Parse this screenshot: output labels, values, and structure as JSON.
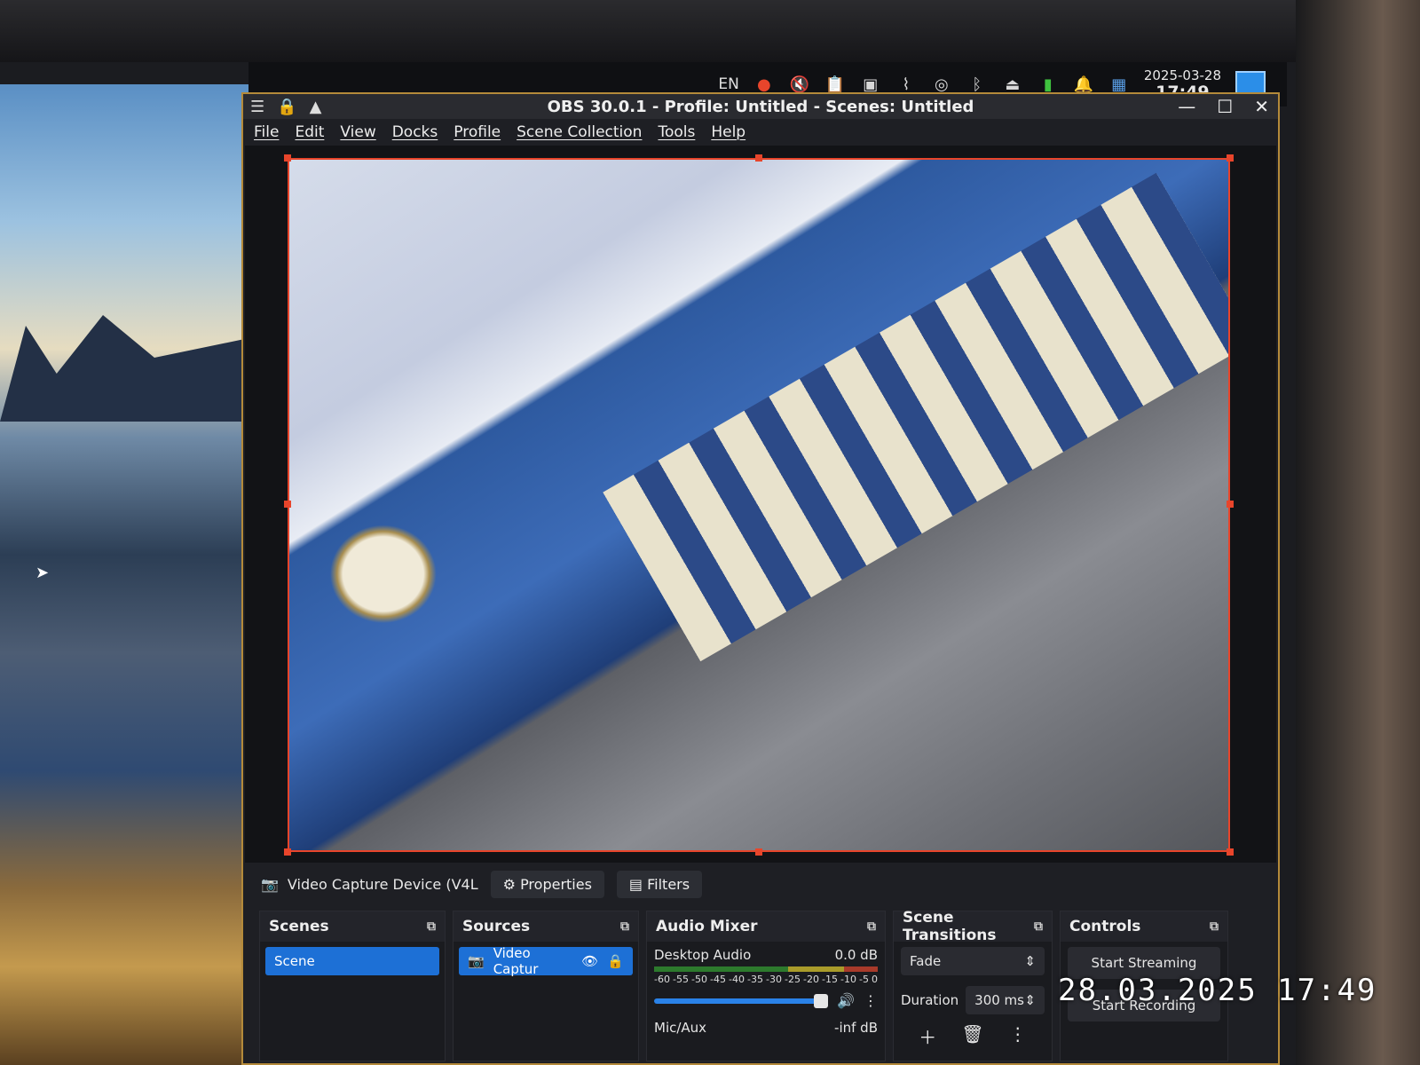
{
  "tray": {
    "language": "EN",
    "date": "2025-03-28",
    "time": "17:49",
    "icons": [
      "microphone-icon",
      "mute-icon",
      "clipboard-icon",
      "screen-icon",
      "paperclip-icon",
      "steam-icon",
      "bluetooth-icon",
      "eject-icon",
      "battery-icon",
      "bell-icon",
      "workspace-icon"
    ]
  },
  "window": {
    "title": "OBS 30.0.1 - Profile: Untitled - Scenes: Untitled",
    "controls": {
      "minimize": "—",
      "maximize": "☐",
      "close": "✕"
    }
  },
  "menu": [
    "File",
    "Edit",
    "View",
    "Docks",
    "Profile",
    "Scene Collection",
    "Tools",
    "Help"
  ],
  "source_bar": {
    "source_name": "Video Capture Device (V4L",
    "properties_label": "Properties",
    "filters_label": "Filters"
  },
  "docks": {
    "scenes": {
      "title": "Scenes",
      "items": [
        "Scene"
      ]
    },
    "sources": {
      "title": "Sources",
      "items": [
        "Video Captur"
      ]
    },
    "audio_mixer": {
      "title": "Audio Mixer",
      "channels": [
        {
          "name": "Desktop Audio",
          "level": "0.0 dB"
        },
        {
          "name": "Mic/Aux",
          "level": "-inf dB"
        }
      ],
      "scale": [
        "-60",
        "-55",
        "-50",
        "-45",
        "-40",
        "-35",
        "-30",
        "-25",
        "-20",
        "-15",
        "-10",
        "-5",
        "0"
      ]
    },
    "transitions": {
      "title": "Scene Transitions",
      "transition": "Fade",
      "duration_label": "Duration",
      "duration": "300 ms"
    },
    "controls": {
      "title": "Controls",
      "start_streaming": "Start Streaming",
      "start_recording": "Start Recording"
    }
  },
  "photo_timestamp": "28.03.2025 17:49"
}
